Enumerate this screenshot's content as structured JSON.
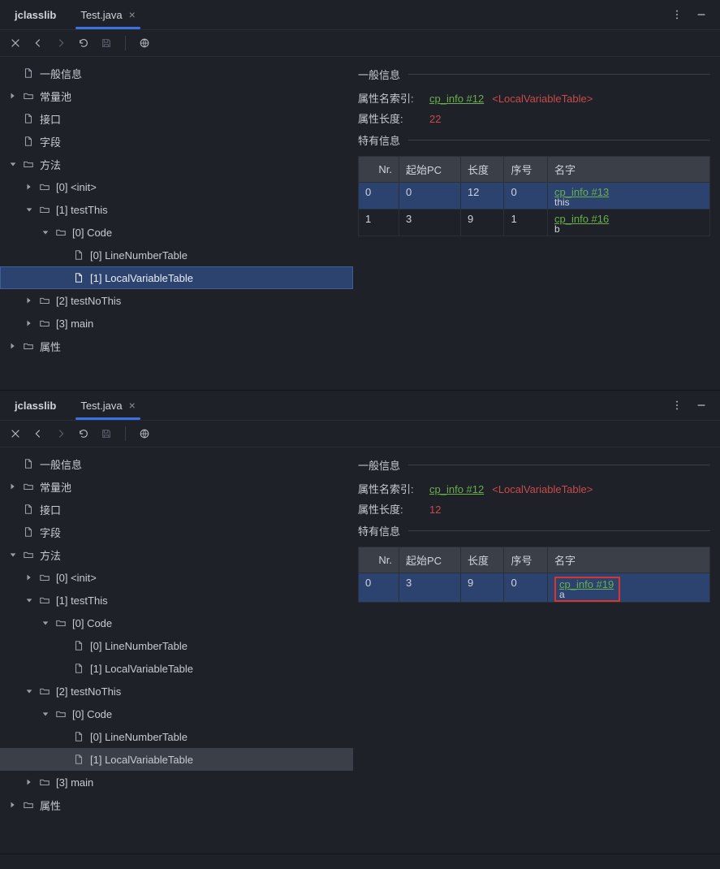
{
  "app_title": "jclasslib",
  "tab_label": "Test.java",
  "tree": {
    "general_info": "一般信息",
    "constant_pool": "常量池",
    "interfaces": "接口",
    "fields": "字段",
    "methods": "方法",
    "m_init": "[0] <init>",
    "m_testThis": "[1] testThis",
    "m_code0": "[0] Code",
    "m_lnt0": "[0] LineNumberTable",
    "m_lvt1": "[1] LocalVariableTable",
    "m_testNoThis": "[2] testNoThis",
    "m_main": "[3] main",
    "attributes": "属性"
  },
  "pane1": {
    "sec_general": "一般信息",
    "attr_name_idx_label": "属性名索引:",
    "attr_name_idx_link": "cp_info #12",
    "attr_name_tag": "<LocalVariableTable>",
    "attr_len_label": "属性长度:",
    "attr_len_value": "22",
    "sec_specific": "特有信息",
    "cols": {
      "nr": "Nr.",
      "startpc": "起始PC",
      "len": "长度",
      "index": "序号",
      "name": "名字"
    },
    "rows": [
      {
        "nr": "0",
        "startpc": "0",
        "len": "12",
        "index": "0",
        "cp": "cp_info #13",
        "sub": "this"
      },
      {
        "nr": "1",
        "startpc": "3",
        "len": "9",
        "index": "1",
        "cp": "cp_info #16",
        "sub": "b"
      }
    ]
  },
  "pane2": {
    "sec_general": "一般信息",
    "attr_name_idx_label": "属性名索引:",
    "attr_name_idx_link": "cp_info #12",
    "attr_name_tag": "<LocalVariableTable>",
    "attr_len_label": "属性长度:",
    "attr_len_value": "12",
    "sec_specific": "特有信息",
    "cols": {
      "nr": "Nr.",
      "startpc": "起始PC",
      "len": "长度",
      "index": "序号",
      "name": "名字"
    },
    "rows": [
      {
        "nr": "0",
        "startpc": "3",
        "len": "9",
        "index": "0",
        "cp": "cp_info #19",
        "sub": "a"
      }
    ]
  }
}
